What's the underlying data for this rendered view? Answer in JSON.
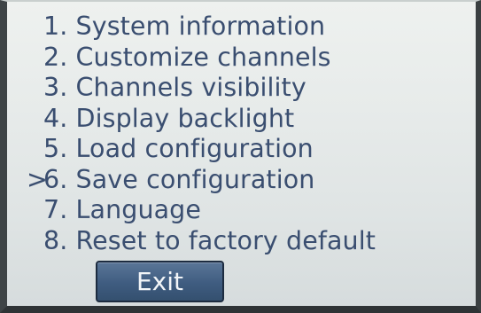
{
  "menu": {
    "items": [
      {
        "label": "1. System information"
      },
      {
        "label": "2. Customize channels"
      },
      {
        "label": "3. Channels visibility"
      },
      {
        "label": "4. Display backlight"
      },
      {
        "label": "5. Load configuration"
      },
      {
        "label": "6. Save configuration",
        "selected": true
      },
      {
        "label": "7. Language"
      },
      {
        "label": "8. Reset to factory default"
      }
    ],
    "cursor_symbol": ">"
  },
  "exit_button": {
    "label": "Exit"
  },
  "colors": {
    "text": "#3a4e70",
    "screen_background": "#e7ebea",
    "button_background": "#3f5c80",
    "button_text": "#f2f5f8"
  }
}
